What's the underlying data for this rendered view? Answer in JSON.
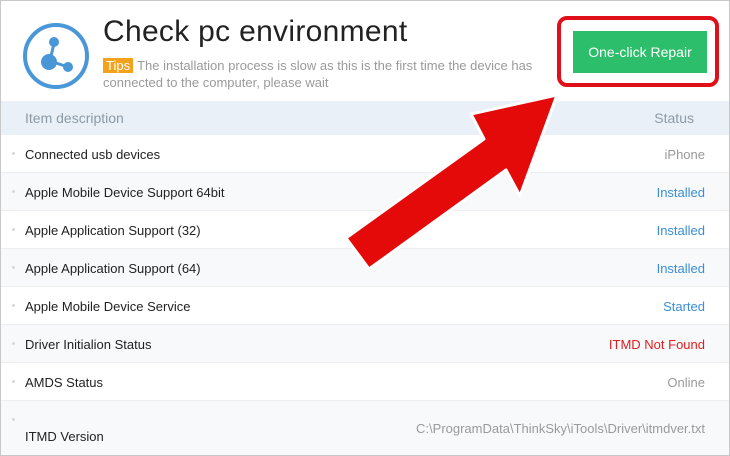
{
  "header": {
    "title": "Check pc environment",
    "tips_badge": "Tips",
    "tips_text": "The installation process is slow as  this is the first time the device has connected to the computer, please wait"
  },
  "repair_button": {
    "label": "One-click Repair"
  },
  "table": {
    "col_description": "Item description",
    "col_status": "Status",
    "rows": [
      {
        "description": "Connected usb devices",
        "status": "iPhone",
        "status_color": "#9a9a9a"
      },
      {
        "description": "Apple Mobile Device Support 64bit",
        "status": "Installed",
        "status_color": "#3a8ed8"
      },
      {
        "description": "Apple Application Support (32)",
        "status": "Installed",
        "status_color": "#3a8ed8"
      },
      {
        "description": "Apple Application Support (64)",
        "status": "Installed",
        "status_color": "#3a8ed8"
      },
      {
        "description": "Apple Mobile Device Service",
        "status": "Started",
        "status_color": "#3a8ed8"
      },
      {
        "description": "Driver Initialion Status",
        "status": "ITMD Not Found",
        "status_color": "#e02020"
      },
      {
        "description": "AMDS Status",
        "status": "Online",
        "status_color": "#9a9a9a"
      },
      {
        "description": "ITMD Version",
        "status": "C:\\ProgramData\\ThinkSky\\iTools\\Driver\\itmdver.txt",
        "status_color": "#9a9a9a"
      }
    ]
  },
  "colors": {
    "accent_green": "#2dbe6c",
    "highlight_red": "#e0101a",
    "logo_blue": "#4a97d8",
    "tips_orange": "#f3a21b"
  },
  "icons": {
    "logo": "share-network-icon",
    "annotation": "red-arrow-icon"
  }
}
